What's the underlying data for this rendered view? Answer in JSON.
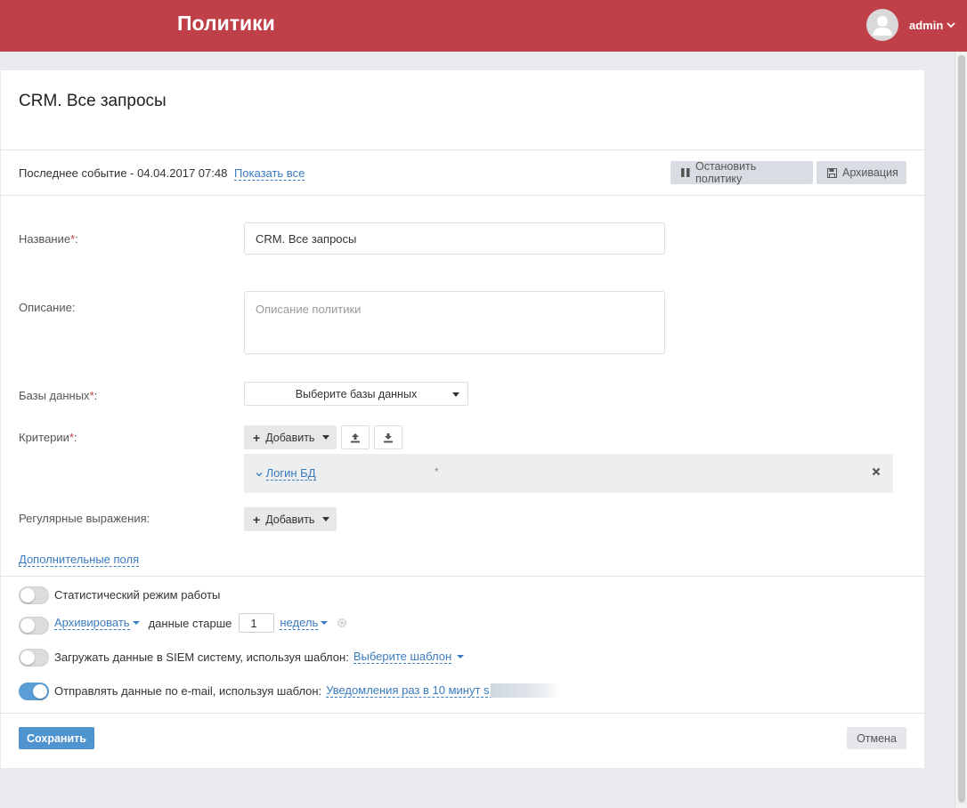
{
  "header": {
    "title": "Политики",
    "user_name": "admin"
  },
  "card": {
    "title": "CRM. Все запросы",
    "last_event_label": "Последнее событие - 04.04.2017 07:48",
    "show_all_link": "Показать все",
    "stop_button": "Остановить политику",
    "archive_button": "Архивация"
  },
  "form": {
    "name_label": "Название",
    "name_value": "CRM. Все запросы",
    "description_label": "Описание:",
    "description_placeholder": "Описание политики",
    "databases_label": "Базы данных",
    "databases_select": "Выберите базы данных",
    "criteria_label": "Критерии",
    "criteria_add": "Добавить",
    "criteria_item": "Логин БД",
    "criteria_star": "*",
    "regex_label": "Регулярные выражения:",
    "regex_add": "Добавить",
    "extra_fields_link": "Дополнительные поля",
    "required_mark": "*"
  },
  "options": {
    "stat_mode": {
      "label": "Статистический режим работы",
      "enabled": false
    },
    "archive": {
      "link": "Архивировать",
      "text": "данные старше",
      "value": "1",
      "unit": "недель",
      "enabled": false
    },
    "siem": {
      "text": "Загружать данные в SIEM систему, используя шаблон:",
      "link": "Выберите шаблон",
      "enabled": false
    },
    "email": {
      "text": "Отправлять данные по e-mail, используя шаблон:",
      "link": "Уведомления раз в 10 минут s.",
      "enabled": true
    }
  },
  "footer": {
    "save": "Сохранить",
    "cancel": "Отмена"
  },
  "colors": {
    "header_bg": "#c0404a",
    "accent": "#4f93cf",
    "link": "#3a7bbf"
  }
}
